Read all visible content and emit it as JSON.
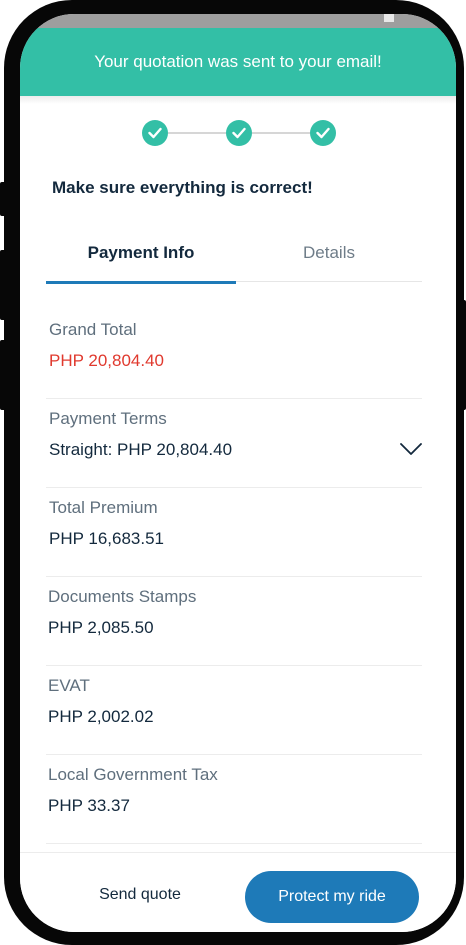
{
  "toast": {
    "message": "Your quotation was sent to your email!"
  },
  "stepper": {
    "steps_completed": 3,
    "steps_total": 3
  },
  "heading": "Make sure everything is correct!",
  "tabs": [
    {
      "label": "Payment Info",
      "active": true
    },
    {
      "label": "Details",
      "active": false
    }
  ],
  "payment": {
    "grand_total": {
      "label": "Grand Total",
      "value": "PHP 20,804.40"
    },
    "payment_terms": {
      "label": "Payment Terms",
      "value": "Straight: PHP 20,804.40"
    },
    "total_premium": {
      "label": "Total Premium",
      "value": "PHP 16,683.51"
    },
    "documents_stamps": {
      "label": "Documents Stamps",
      "value": "PHP 2,085.50"
    },
    "evat": {
      "label": "EVAT",
      "value": "PHP 2,002.02"
    },
    "local_government_tax": {
      "label": "Local Government Tax",
      "value": "PHP 33.37"
    }
  },
  "footer": {
    "send_quote_label": "Send quote",
    "protect_label": "Protect my ride"
  },
  "colors": {
    "accent_green": "#33bfa6",
    "primary_blue": "#1e7ab8",
    "total_red": "#e0392e",
    "text_dark": "#13293d"
  },
  "icons": {
    "step": "check-circle-icon",
    "dropdown": "chevron-down-icon"
  }
}
